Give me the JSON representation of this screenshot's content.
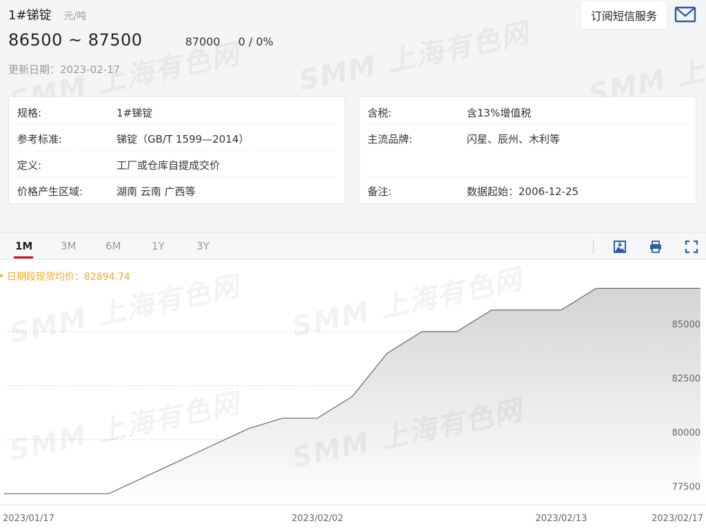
{
  "header": {
    "title": "1#锑锭",
    "unit": "元/吨",
    "price_range": "86500 ~ 87500",
    "average": "87000",
    "change": "0  /  0%",
    "date_label": "更新日期：",
    "date_value": "2023-02-17",
    "subscribe_label": "订阅短信服务",
    "mail_icon": "mail-icon"
  },
  "details_left": [
    {
      "key": "规格:",
      "value": "1#锑锭"
    },
    {
      "key": "参考标准:",
      "value": "锑锭（GB/T 1599—2014）"
    },
    {
      "key": "定义:",
      "value": "工厂或仓库自提成交价"
    },
    {
      "key": "价格产生区域:",
      "value": "湖南 云南 广西等"
    }
  ],
  "details_right": [
    {
      "key": "含税:",
      "value": "含13%增值税"
    },
    {
      "key": "主流品牌:",
      "value": "闪星、辰州、木利等"
    },
    {
      "key": "",
      "value": ""
    },
    {
      "key": "备注:",
      "value": "数据起始：2006-12-25"
    }
  ],
  "tabs": [
    {
      "label": "1M",
      "active": true
    },
    {
      "label": "3M",
      "active": false
    },
    {
      "label": "6M",
      "active": false
    },
    {
      "label": "1Y",
      "active": false
    },
    {
      "label": "3Y",
      "active": false
    }
  ],
  "tools": [
    "image-save-icon",
    "print-icon",
    "fullscreen-icon"
  ],
  "avg_label": "日期段现货均价：82894.74",
  "watermark": "SMM 上海有色网",
  "colors": {
    "accent": "#d0021b",
    "avg_label": "#f5a623",
    "toolbar_icon": "#2b5aa8",
    "line": "#666666"
  },
  "chart_data": {
    "type": "area",
    "x": [
      "2023/01/17",
      "2023/01/18",
      "2023/01/19",
      "2023/01/20",
      "2023/01/28",
      "2023/01/29",
      "2023/01/30",
      "2023/01/31",
      "2023/02/01",
      "2023/02/02",
      "2023/02/03",
      "2023/02/06",
      "2023/02/07",
      "2023/02/08",
      "2023/02/09",
      "2023/02/10",
      "2023/02/13",
      "2023/02/14",
      "2023/02/15",
      "2023/02/16",
      "2023/02/17"
    ],
    "values": [
      77500,
      77500,
      77500,
      77500,
      78250,
      79000,
      79750,
      80500,
      81000,
      81000,
      82000,
      84000,
      85000,
      85000,
      86000,
      86000,
      86000,
      87000,
      87000,
      87000,
      87000
    ],
    "x_tick_labels": [
      "2023/01/17",
      "2023/02/02",
      "2023/02/13",
      "2023/02/17"
    ],
    "y_ticks": [
      77500,
      80000,
      82500,
      85000
    ],
    "ylim": [
      77000,
      88000
    ],
    "grid": true
  }
}
